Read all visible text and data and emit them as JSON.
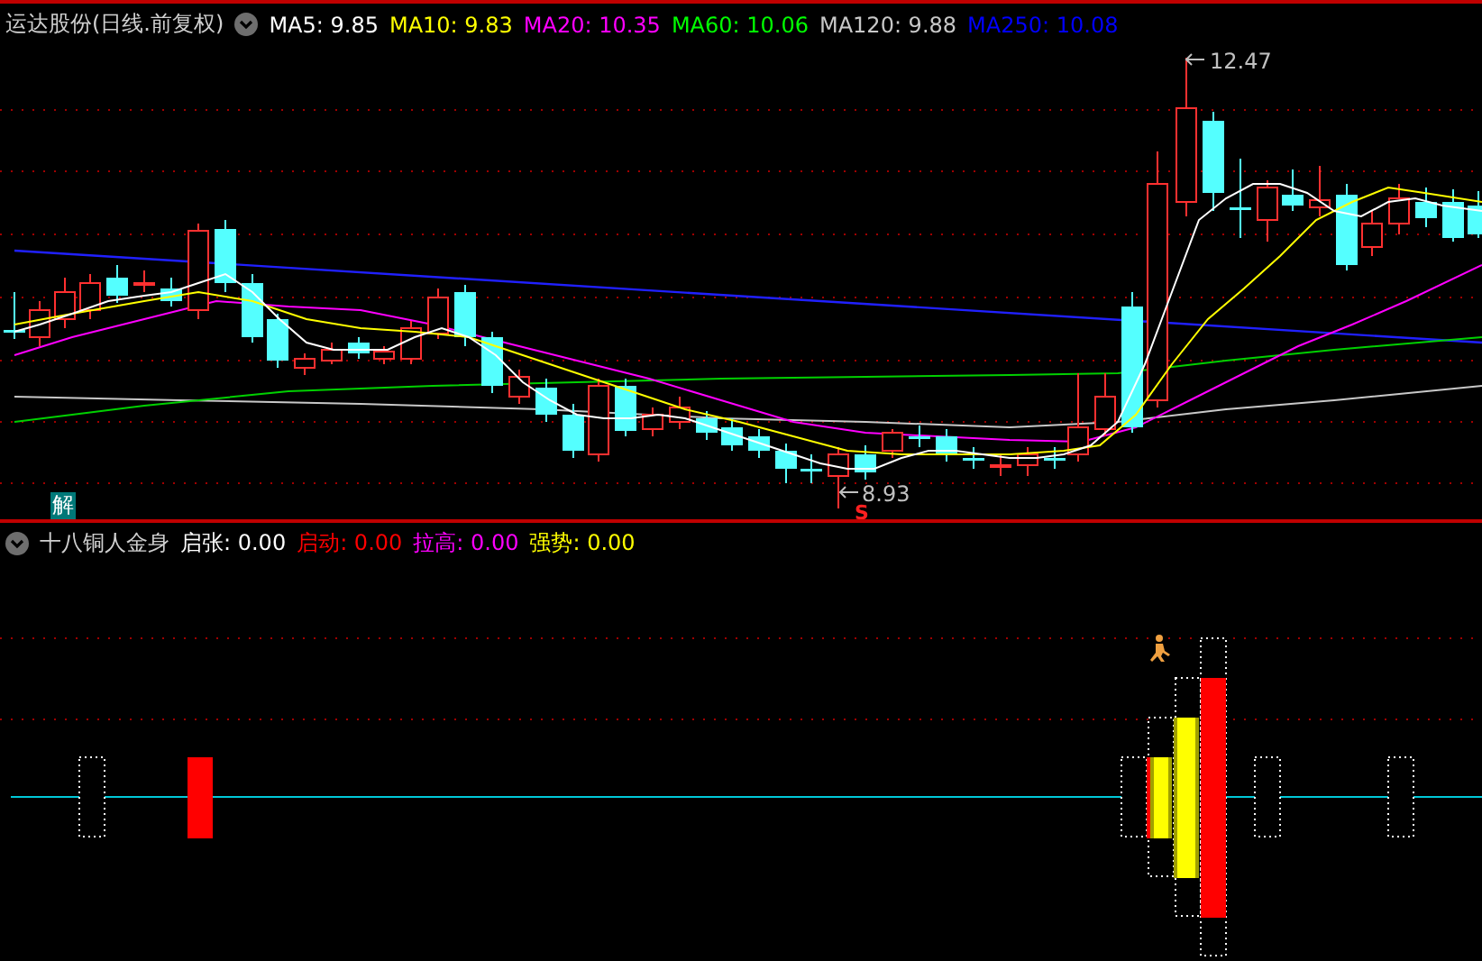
{
  "main_chart": {
    "title": "运达股份(日线.前复权)",
    "indicators": [
      {
        "text": "MA5: 9.85",
        "color": "#ffffff"
      },
      {
        "text": "MA10: 9.83",
        "color": "#ffff00"
      },
      {
        "text": "MA20: 10.35",
        "color": "#ff00ff"
      },
      {
        "text": "MA60: 10.06",
        "color": "#00ff00"
      },
      {
        "text": "MA120: 9.88",
        "color": "#c8c8c8"
      },
      {
        "text": "MA250: 10.08",
        "color": "#0000ff"
      }
    ],
    "high_label": "12.47",
    "low_label": "8.93",
    "signal_mark": "S",
    "badge": "解"
  },
  "indicator_panel": {
    "title": "十八铜人金身",
    "indicators": [
      {
        "text": "启张: 0.00",
        "color": "#ffffff"
      },
      {
        "text": "启动: 0.00",
        "color": "#ff0000"
      },
      {
        "text": "拉高: 0.00",
        "color": "#ff00ff"
      },
      {
        "text": "强势: 0.00",
        "color": "#ffff00"
      }
    ]
  }
}
